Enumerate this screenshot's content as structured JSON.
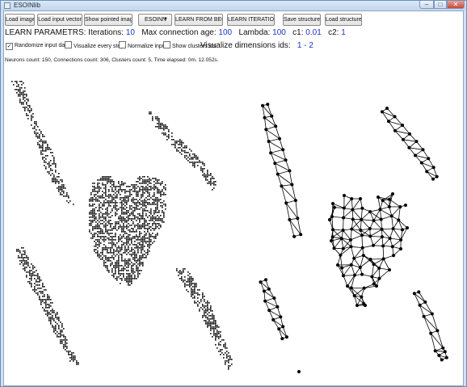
{
  "window": {
    "title": "ESOINlib",
    "minimize_glyph": "–",
    "maximize_glyph": "□",
    "close_glyph": "✕"
  },
  "toolbar": {
    "buttons": [
      {
        "id": "load-image",
        "label": "Load image"
      },
      {
        "id": "load-input-vector",
        "label": "Load input vector"
      },
      {
        "id": "show-pointed-image",
        "label": "Show pointed image"
      },
      {
        "id": "learn-from-begin",
        "label": "LEARN FROM BEGIN"
      },
      {
        "id": "learn-iterations",
        "label": "LEARN ITERATIONS"
      },
      {
        "id": "save-structure",
        "label": "Save structure"
      },
      {
        "id": "load-structure",
        "label": "Load structure"
      }
    ],
    "algorithm_select": {
      "value": "ESOINN",
      "arrow": "▼"
    }
  },
  "params": {
    "heading": "LEARN PARAMETRS:",
    "iterations_label": "Iterations:",
    "iterations_value": "10",
    "max_age_label": "Max connection age:",
    "max_age_value": "100",
    "lambda_label": "Lambda:",
    "lambda_value": "100",
    "c1_label": "c1:",
    "c1_value": "0.01",
    "c2_label": "c2:",
    "c2_value": "1"
  },
  "visualize_dims": {
    "label": "Visualize dimensions ids:",
    "dim1": "1",
    "separator": "-",
    "dim2": "2"
  },
  "options": [
    {
      "id": "randomize",
      "label": "Randomize input data",
      "checked": true
    },
    {
      "id": "visualize-every-step",
      "label": "Visualize every step",
      "checked": false
    },
    {
      "id": "normalize-input",
      "label": "Normalize input",
      "checked": false
    },
    {
      "id": "show-clusters-ids",
      "label": "Show clusters ids",
      "checked": false
    }
  ],
  "check_glyph": "✓",
  "status": "Neurons count: 150, Connections count: 306, Clusters count: 5, Time elapsed: 0m. 12.052s."
}
